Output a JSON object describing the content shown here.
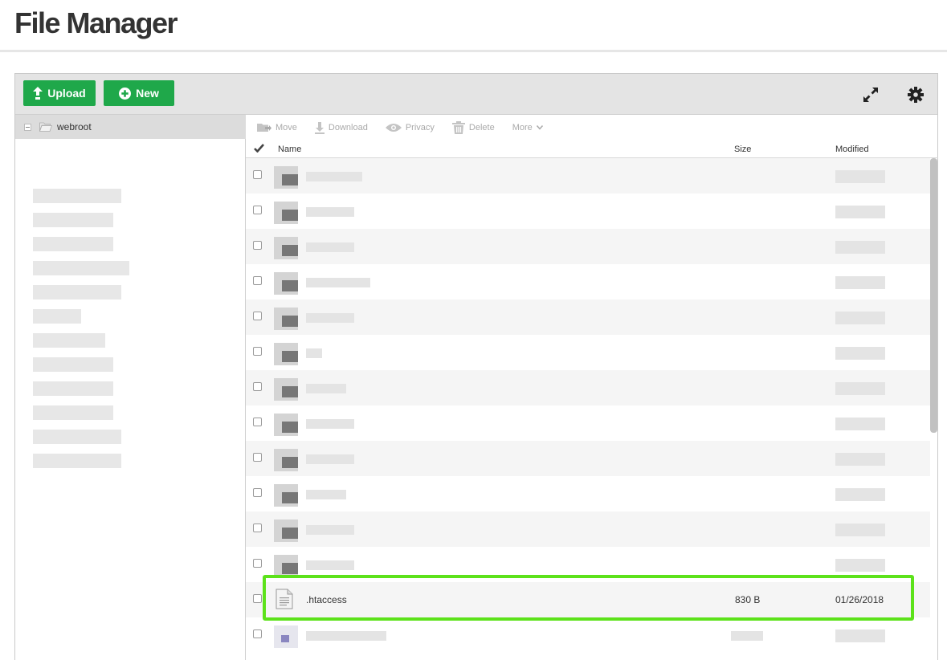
{
  "page": {
    "title": "File Manager"
  },
  "toolbar": {
    "upload_label": "Upload",
    "new_label": "New",
    "icons": {
      "upload": "upload-arrow-icon",
      "new": "plus-circle-icon",
      "expand": "expand-icon",
      "settings": "gear-icon"
    },
    "accent_color": "#1fa84a"
  },
  "tree": {
    "root_label": "webroot",
    "root_icon": "folder-open-icon"
  },
  "actions": {
    "move": "Move",
    "download": "Download",
    "privacy": "Privacy",
    "delete": "Delete",
    "more": "More"
  },
  "table": {
    "columns": {
      "name": "Name",
      "size": "Size",
      "modified": "Modified"
    },
    "visible_file": {
      "name": ".htaccess",
      "size": "830 B",
      "modified": "01/26/2018",
      "icon": "document-icon"
    }
  },
  "highlight_color": "#5ce21a"
}
